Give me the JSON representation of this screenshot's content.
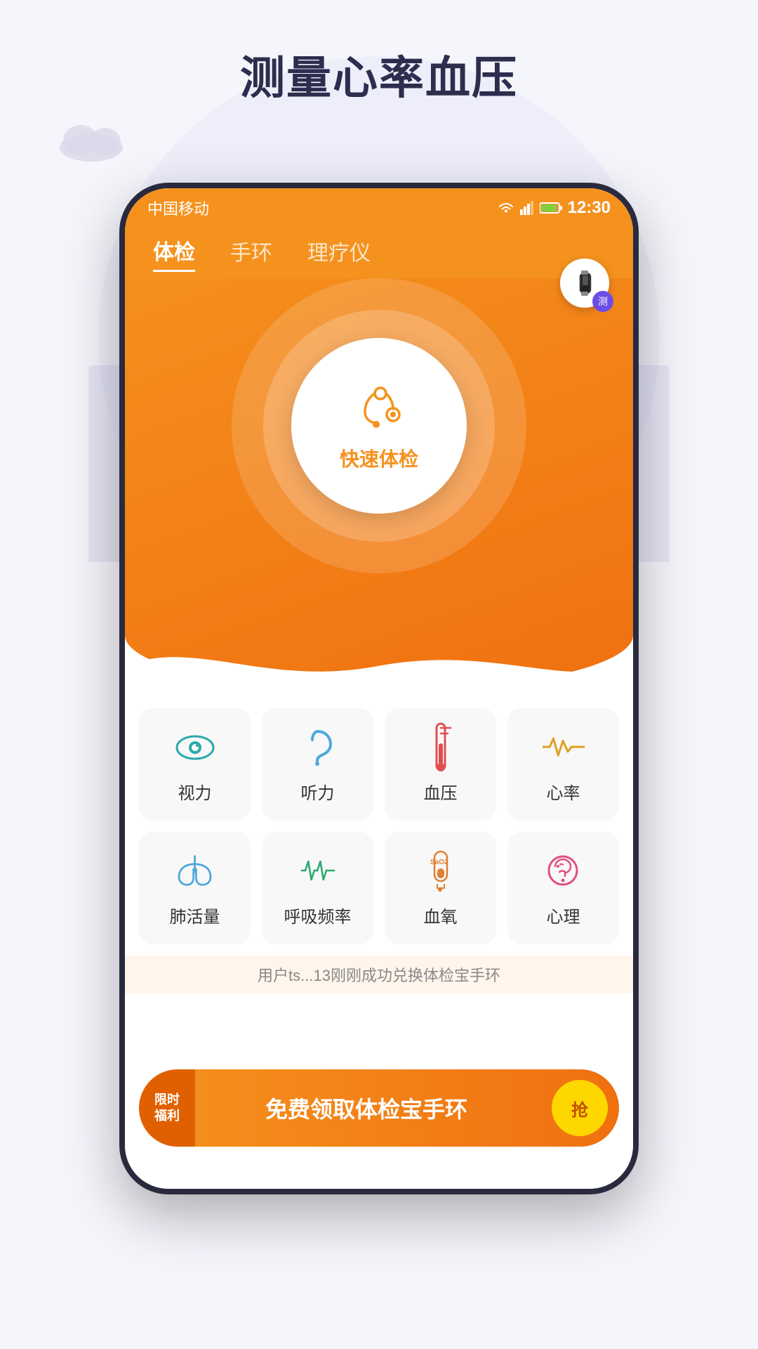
{
  "page": {
    "title": "测量心率血压",
    "background_color": "#f5f5fc"
  },
  "status_bar": {
    "carrier": "中国移动",
    "time": "12:30",
    "wifi_icon": "wifi",
    "signal_icon": "signal",
    "battery_icon": "battery"
  },
  "tabs": [
    {
      "id": "tijian",
      "label": "体检",
      "active": true
    },
    {
      "id": "shuhuan",
      "label": "手环",
      "active": false
    },
    {
      "id": "liaoyi",
      "label": "理疗仪",
      "active": false
    }
  ],
  "wristband_button": {
    "badge": "测"
  },
  "main_button": {
    "label": "快速体检",
    "icon": "stethoscope"
  },
  "grid_row1": [
    {
      "id": "vision",
      "label": "视力",
      "icon": "eye",
      "color": "#2baaaa"
    },
    {
      "id": "hearing",
      "label": "听力",
      "icon": "ear",
      "color": "#4da8da"
    },
    {
      "id": "blood_pressure",
      "label": "血压",
      "icon": "thermometer",
      "color": "#e05050"
    },
    {
      "id": "heart_rate",
      "label": "心率",
      "icon": "heartrate",
      "color": "#e0a020"
    }
  ],
  "grid_row2": [
    {
      "id": "lung",
      "label": "肺活量",
      "icon": "lungs",
      "color": "#4da8da"
    },
    {
      "id": "breath",
      "label": "呼吸频率",
      "icon": "breath",
      "color": "#2baa70"
    },
    {
      "id": "blood_oxygen",
      "label": "血氧",
      "icon": "test_tube",
      "color": "#e08030"
    },
    {
      "id": "psychology",
      "label": "心理",
      "icon": "brain_heart",
      "color": "#e05080"
    }
  ],
  "notification": {
    "text": "用户ts...13刚刚成功兑换体检宝手环"
  },
  "banner": {
    "tag_line1": "限时",
    "tag_line2": "福利",
    "main_text": "免费领取体检宝手环",
    "button_label": "抢"
  }
}
